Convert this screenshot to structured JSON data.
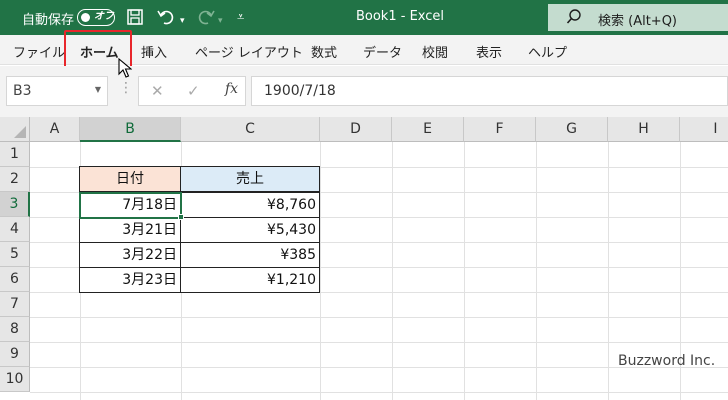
{
  "titlebar": {
    "autosave_label": "自動保存",
    "toggle_label": "オフ",
    "title": "Book1 - Excel",
    "search_placeholder": "検索 (Alt+Q)",
    "bg_color": "#217346"
  },
  "menu": {
    "tabs": [
      {
        "label": "ファイル"
      },
      {
        "label": "ホーム"
      },
      {
        "label": "挿入"
      },
      {
        "label": "ページ レイアウト"
      },
      {
        "label": "数式"
      },
      {
        "label": "データ"
      },
      {
        "label": "校閲"
      },
      {
        "label": "表示"
      },
      {
        "label": "ヘルプ"
      }
    ],
    "active_tab": "ホーム",
    "highlight_color": "#e8262b"
  },
  "formula_bar": {
    "name_box": "B3",
    "fx_label": "fx",
    "formula": "1900/7/18"
  },
  "grid": {
    "columns": [
      "A",
      "B",
      "C",
      "D",
      "E",
      "F",
      "G",
      "H",
      "I"
    ],
    "rows": [
      "1",
      "2",
      "3",
      "4",
      "5",
      "6",
      "7",
      "8",
      "9",
      "10"
    ],
    "selected_column": "B",
    "selected_row": "3",
    "accent_color": "#217346"
  },
  "table": {
    "headers": [
      "日付",
      "売上"
    ],
    "header_colors": [
      "#fbe3d6",
      "#dcebf7"
    ],
    "rows": [
      {
        "date": "7月18日",
        "sales": "¥8,760"
      },
      {
        "date": "3月21日",
        "sales": "¥5,430"
      },
      {
        "date": "3月22日",
        "sales": "¥385"
      },
      {
        "date": "3月23日",
        "sales": "¥1,210"
      }
    ]
  },
  "watermark": "Buzzword Inc."
}
